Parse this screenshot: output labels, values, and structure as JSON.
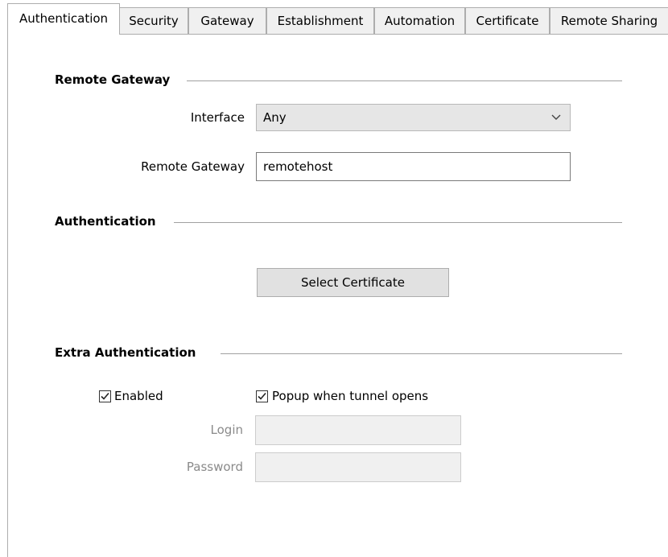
{
  "tabs": [
    {
      "label": "Authentication",
      "active": true
    },
    {
      "label": "Security",
      "active": false
    },
    {
      "label": "Gateway",
      "active": false
    },
    {
      "label": "Establishment",
      "active": false
    },
    {
      "label": "Automation",
      "active": false
    },
    {
      "label": "Certificate",
      "active": false
    },
    {
      "label": "Remote Sharing",
      "active": false
    }
  ],
  "remote_gateway_section": {
    "title": "Remote Gateway",
    "interface_label": "Interface",
    "interface_value": "Any",
    "remote_gateway_label": "Remote Gateway",
    "remote_gateway_value": "remotehost"
  },
  "authentication_section": {
    "title": "Authentication",
    "select_certificate_label": "Select Certificate"
  },
  "extra_authentication_section": {
    "title": "Extra Authentication",
    "enabled_label": "Enabled",
    "enabled_checked": true,
    "popup_label": "Popup when tunnel opens",
    "popup_checked": true,
    "login_label": "Login",
    "login_value": "",
    "password_label": "Password",
    "password_value": ""
  },
  "icons": {
    "interface_dropdown": "chevron-down-icon",
    "checkbox_mark": "checkmark-icon"
  }
}
